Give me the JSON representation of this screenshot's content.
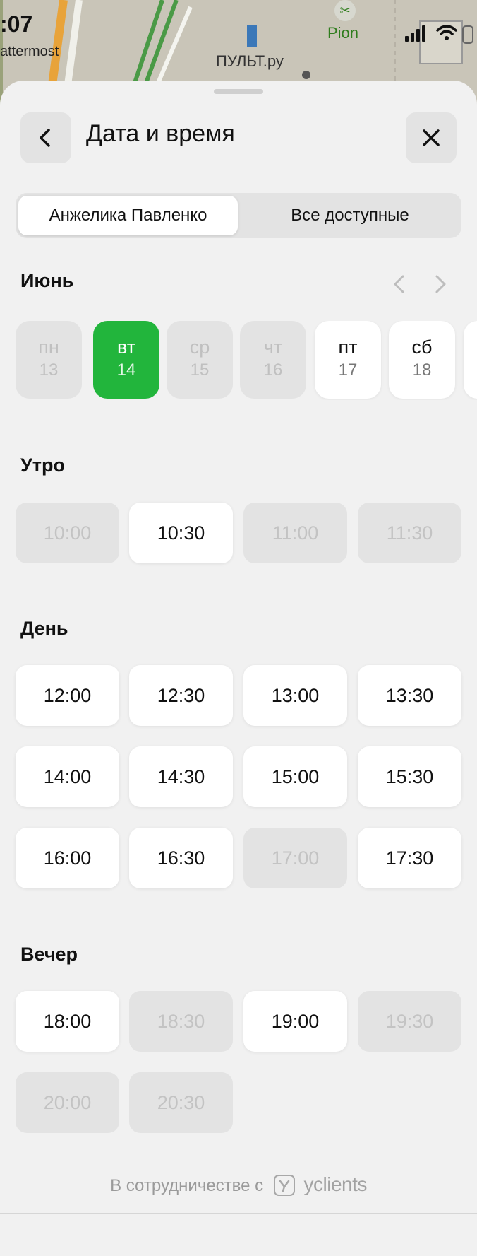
{
  "status": {
    "time": ":07",
    "app_label": "attermost"
  },
  "map": {
    "place_shop": "ПУЛЬТ.ру",
    "place_pion": "Pion"
  },
  "header": {
    "title": "Дата и время"
  },
  "staff_toggle": {
    "selected": "Анжелика Павленко",
    "other": "Все доступные"
  },
  "calendar": {
    "month": "Июнь",
    "days": [
      {
        "name": "пн",
        "num": "13",
        "state": "disabled"
      },
      {
        "name": "вт",
        "num": "14",
        "state": "selected"
      },
      {
        "name": "ср",
        "num": "15",
        "state": "disabled"
      },
      {
        "name": "чт",
        "num": "16",
        "state": "disabled"
      },
      {
        "name": "пт",
        "num": "17",
        "state": "available"
      },
      {
        "name": "сб",
        "num": "18",
        "state": "available"
      }
    ]
  },
  "sections": {
    "morning": {
      "title": "Утро",
      "slots": [
        {
          "time": "10:00",
          "available": false
        },
        {
          "time": "10:30",
          "available": true
        },
        {
          "time": "11:00",
          "available": false
        },
        {
          "time": "11:30",
          "available": false
        }
      ]
    },
    "day": {
      "title": "День",
      "slots": [
        {
          "time": "12:00",
          "available": true
        },
        {
          "time": "12:30",
          "available": true
        },
        {
          "time": "13:00",
          "available": true
        },
        {
          "time": "13:30",
          "available": true
        },
        {
          "time": "14:00",
          "available": true
        },
        {
          "time": "14:30",
          "available": true
        },
        {
          "time": "15:00",
          "available": true
        },
        {
          "time": "15:30",
          "available": true
        },
        {
          "time": "16:00",
          "available": true
        },
        {
          "time": "16:30",
          "available": true
        },
        {
          "time": "17:00",
          "available": false
        },
        {
          "time": "17:30",
          "available": true
        }
      ]
    },
    "evening": {
      "title": "Вечер",
      "slots": [
        {
          "time": "18:00",
          "available": true
        },
        {
          "time": "18:30",
          "available": false
        },
        {
          "time": "19:00",
          "available": true
        },
        {
          "time": "19:30",
          "available": false
        },
        {
          "time": "20:00",
          "available": false
        },
        {
          "time": "20:30",
          "available": false
        }
      ]
    }
  },
  "footer": {
    "text": "В сотрудничестве с",
    "brand": "yclients"
  },
  "colors": {
    "accent": "#22b53c",
    "sheet_bg": "#f1f1f1",
    "disabled_bg": "#e3e3e3"
  },
  "icons": {
    "back": "chevron-left-icon",
    "close": "close-icon",
    "prev": "chevron-left-icon",
    "next": "chevron-right-icon"
  }
}
